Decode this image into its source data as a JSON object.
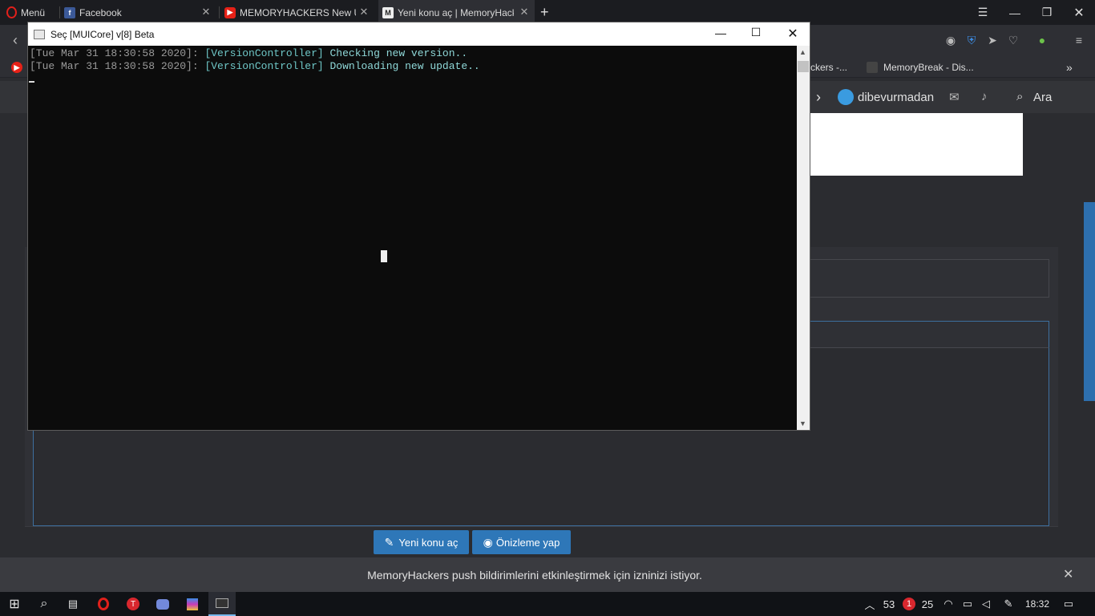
{
  "browser": {
    "menu_label": "Menü",
    "tabs": [
      {
        "title": "Facebook",
        "icon": "facebook-icon"
      },
      {
        "title": "MEMORYHACKERS New UI",
        "icon": "youtube-icon"
      },
      {
        "title": "Yeni konu aç | MemoryHacke",
        "icon": "memoryhackers-icon"
      }
    ],
    "bookmarks": [
      {
        "label": "ckers -..."
      },
      {
        "label": "MemoryBreak - Dis..."
      }
    ]
  },
  "site": {
    "username": "dibevurmadan",
    "search_label": "Ara",
    "buttons": {
      "new_topic": "Yeni konu aç",
      "preview": "Önizleme yap"
    },
    "push_message": "MemoryHackers push bildirimlerini etkinleştirmek için izninizi istiyor."
  },
  "console": {
    "title": "Seç [MUICore] v[8] Beta",
    "lines": [
      {
        "ts": "[Tue Mar 31 18:30:58 2020]:",
        "module": "[VersionController]",
        "msg": "Checking new version.."
      },
      {
        "ts": "[Tue Mar 31 18:30:58 2020]:",
        "module": "[VersionController]",
        "msg": "Downloading new update.."
      }
    ]
  },
  "taskbar": {
    "tray_num1": "53",
    "tray_badge": "1",
    "tray_num2": "25",
    "clock": "18:32"
  },
  "colors": {
    "accent": "#2e77b8",
    "console_bg": "#0c0c0c",
    "opera_red": "#e0201b"
  }
}
